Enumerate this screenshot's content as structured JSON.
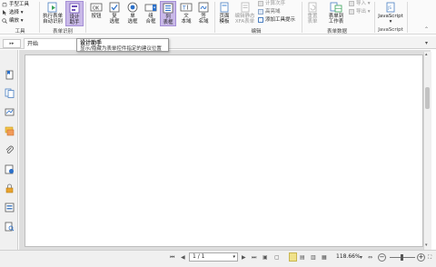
{
  "ribbon": {
    "hand_tool": "手型工具",
    "select": "选择",
    "zoom": "编放",
    "tools_group": "工具",
    "run_form": "执行表单",
    "run_form_2": "自动识别",
    "design_assist": "设计",
    "design_assist_2": "助手",
    "form_recog_group": "表单识别",
    "btn_ok": "按钮",
    "checkbox": "复",
    "checkbox_2": "选框",
    "radio": "单",
    "radio_2": "选框",
    "combo": "组",
    "combo_2": "合框",
    "listbox": "列",
    "listbox_2": "表框",
    "textfield": "文",
    "textfield_2": "本域",
    "signature": "签",
    "signature_2": "名域",
    "page_template": "页面",
    "page_template_2": "模板",
    "static_xfa": "编辑静态",
    "static_xfa_2": "XFA表单",
    "calc_order": "计算次序",
    "highlight": "高亮域",
    "add_tooltip": "添加工具提示",
    "edit_group": "编辑",
    "reset_form": "重置",
    "reset_form_2": "表单",
    "form_to_sheet": "表单到",
    "form_to_sheet_2": "工作表",
    "import": "导入",
    "export": "导出",
    "form_data_group": "表单数据",
    "javascript": "JavaScript",
    "javascript_group": "JavaScript"
  },
  "tabs": {
    "doc_tab": "开始"
  },
  "tooltip": {
    "title": "设计助手",
    "desc": "显示/隐藏为表单控件指定的建议位置"
  },
  "status": {
    "page_value": "1 / 1",
    "zoom_value": "118.66%"
  },
  "colors": {
    "active_button": "#c9b9e8",
    "accent": "#a58fd6"
  }
}
